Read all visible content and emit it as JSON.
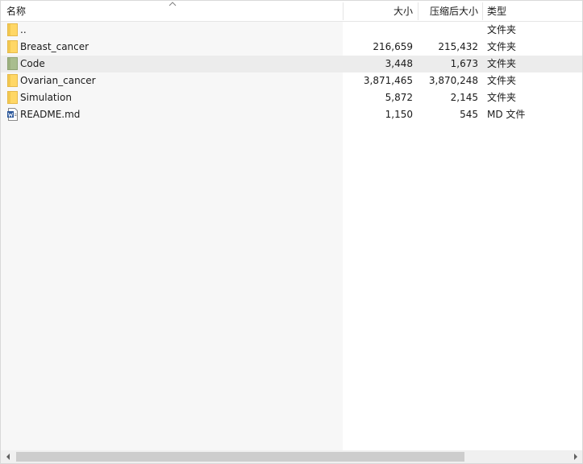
{
  "columns": {
    "name": "名称",
    "size": "大小",
    "packed": "压缩后大小",
    "type": "类型"
  },
  "sort_icon": "sort-up-icon",
  "rows": [
    {
      "name": "..",
      "size": "",
      "packed": "",
      "type": "文件夹",
      "icon": "folder-icon"
    },
    {
      "name": "Breast_cancer",
      "size": "216,659",
      "packed": "215,432",
      "type": "文件夹",
      "icon": "folder-icon"
    },
    {
      "name": "Code",
      "size": "3,448",
      "packed": "1,673",
      "type": "文件夹",
      "icon": "folder-icon"
    },
    {
      "name": "Ovarian_cancer",
      "size": "3,871,465",
      "packed": "3,870,248",
      "type": "文件夹",
      "icon": "folder-icon"
    },
    {
      "name": "Simulation",
      "size": "5,872",
      "packed": "2,145",
      "type": "文件夹",
      "icon": "folder-icon"
    },
    {
      "name": "README.md",
      "size": "1,150",
      "packed": "545",
      "type": "MD 文件",
      "icon": "document-icon"
    }
  ],
  "selected_row": "Code",
  "colors": {
    "folder": "#ffd766",
    "folder_selected": "#a9bd8e",
    "selection": "#ececec",
    "document": "#2b579a"
  },
  "scrollbar": {
    "left_icon": "arrow-left-icon",
    "right_icon": "arrow-right-icon"
  }
}
